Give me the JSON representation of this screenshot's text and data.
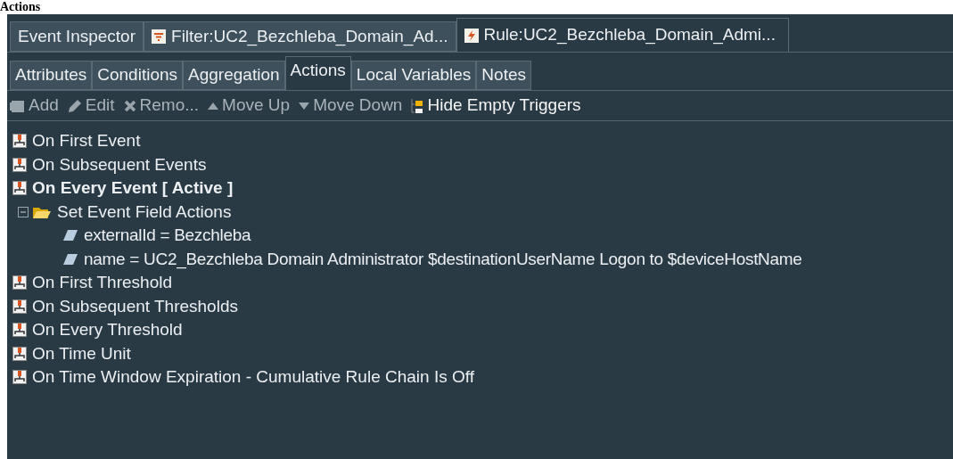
{
  "heading": "Actions",
  "editor_tabs": [
    {
      "label": "Event Inspector",
      "kind": "plain",
      "selected": false
    },
    {
      "label": "Filter:UC2_Bezchleba_Domain_Ad...",
      "kind": "filter",
      "selected": false
    },
    {
      "label": "Rule:UC2_Bezchleba_Domain_Admi...",
      "kind": "rule",
      "selected": true
    }
  ],
  "sub_tabs": [
    {
      "label": "Attributes",
      "selected": false
    },
    {
      "label": "Conditions",
      "selected": false
    },
    {
      "label": "Aggregation",
      "selected": false
    },
    {
      "label": "Actions",
      "selected": true
    },
    {
      "label": "Local Variables",
      "selected": false
    },
    {
      "label": "Notes",
      "selected": false
    }
  ],
  "toolbar": [
    {
      "label": "Add",
      "kind": "add",
      "disabled": true
    },
    {
      "label": "Edit",
      "kind": "edit",
      "disabled": true
    },
    {
      "label": "Remo...",
      "kind": "remove",
      "disabled": true
    },
    {
      "label": "Move Up",
      "kind": "up",
      "disabled": true
    },
    {
      "label": "Move Down",
      "kind": "down",
      "disabled": true
    },
    {
      "label": "Hide Empty Triggers",
      "kind": "hide",
      "disabled": false
    }
  ],
  "triggers": [
    {
      "label": "On First Event",
      "active": false
    },
    {
      "label": "On Subsequent Events",
      "active": false
    },
    {
      "label": "On Every Event [ Active ]",
      "active": true,
      "children": [
        {
          "label": "Set Event Field Actions",
          "expanded": true,
          "children": [
            {
              "label": "externalId = Bezchleba"
            },
            {
              "label": "name = UC2_Bezchleba Domain Administrator $destinationUserName Logon to $deviceHostName"
            }
          ]
        }
      ]
    },
    {
      "label": "On First Threshold",
      "active": false
    },
    {
      "label": "On Subsequent Thresholds",
      "active": false
    },
    {
      "label": "On Every Threshold",
      "active": false
    },
    {
      "label": "On Time Unit",
      "active": false
    },
    {
      "label": "On Time Window Expiration - Cumulative Rule Chain Is Off",
      "active": false
    }
  ]
}
